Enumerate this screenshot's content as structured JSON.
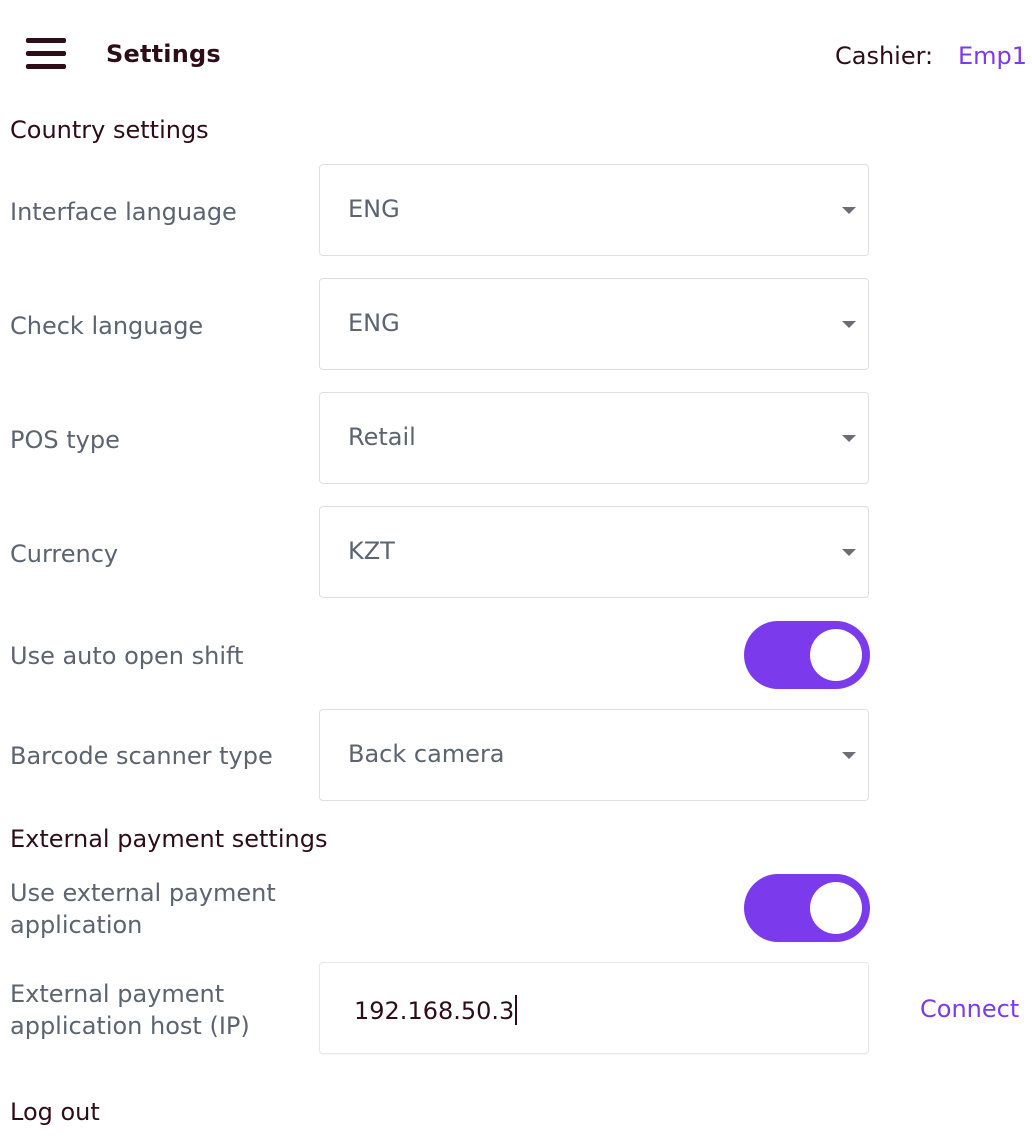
{
  "header": {
    "title": "Settings",
    "cashier_label": "Cashier:",
    "cashier_name": "Emp1"
  },
  "country_settings": {
    "title": "Country settings",
    "interface_language": {
      "label": "Interface language",
      "value": "ENG"
    },
    "check_language": {
      "label": "Check language",
      "value": "ENG"
    },
    "pos_type": {
      "label": "POS type",
      "value": "Retail"
    },
    "currency": {
      "label": "Currency",
      "value": "KZT"
    },
    "auto_open_shift": {
      "label": "Use auto open shift",
      "enabled": true
    },
    "barcode_scanner": {
      "label": "Barcode scanner type",
      "value": "Back camera"
    }
  },
  "external_payment": {
    "title": "External payment settings",
    "use_app": {
      "label_line1": "Use external payment",
      "label_line2": "application",
      "enabled": true
    },
    "host": {
      "label_line1": "External payment",
      "label_line2": "application host (IP)",
      "value": "192.168.50.3"
    },
    "connect_label": "Connect"
  },
  "logout_label": "Log out",
  "colors": {
    "accent": "#7c3aed",
    "header_text": "#2d0e18",
    "label_text": "#5c6470"
  },
  "icons": {
    "menu": "hamburger-menu-icon",
    "dropdown": "chevron-down-icon"
  }
}
